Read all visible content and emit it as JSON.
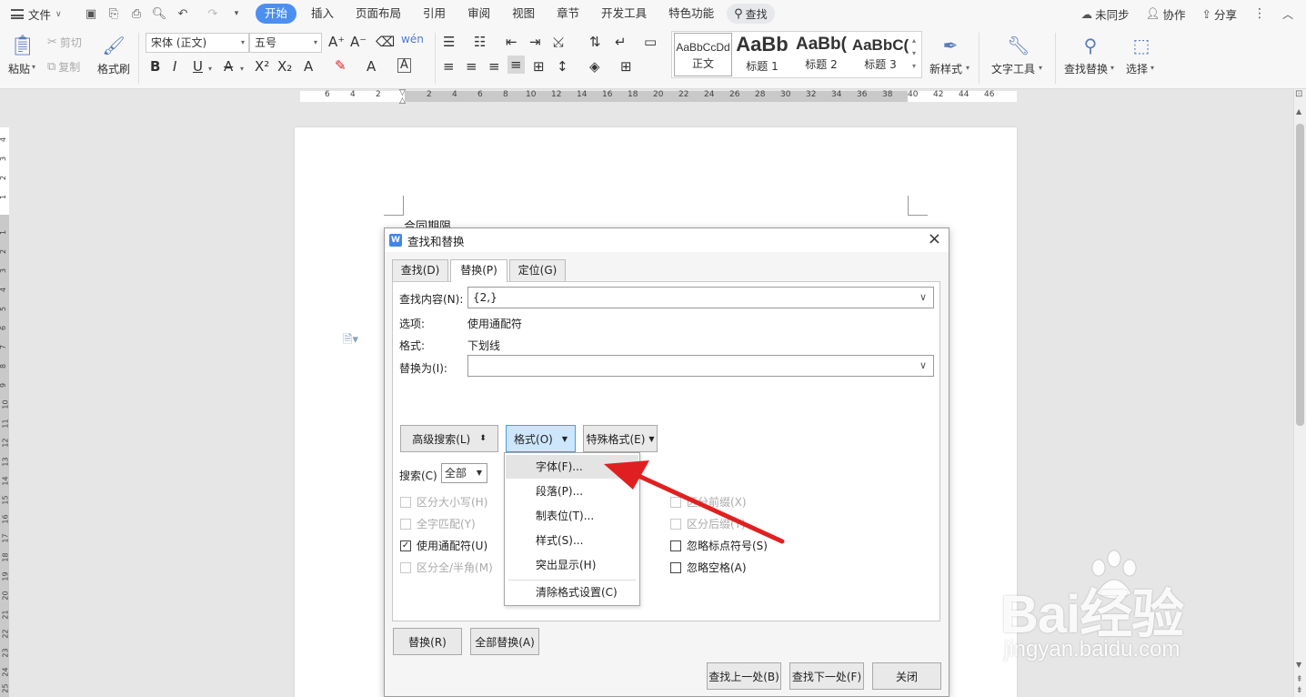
{
  "menubar": {
    "file": "文件",
    "tabs": [
      {
        "label": "开始",
        "active": true
      },
      {
        "label": "插入"
      },
      {
        "label": "页面布局"
      },
      {
        "label": "引用"
      },
      {
        "label": "审阅"
      },
      {
        "label": "视图"
      },
      {
        "label": "章节"
      },
      {
        "label": "开发工具"
      },
      {
        "label": "特色功能"
      }
    ],
    "search": "查找",
    "sync": "未同步",
    "collab": "协作",
    "share": "分享"
  },
  "ribbon": {
    "paste": "粘贴",
    "cut": "剪切",
    "copy": "复制",
    "format_painter": "格式刷",
    "font_name": "宋体 (正文)",
    "font_size": "五号",
    "styles": [
      {
        "preview": "AaBbCcDd",
        "name": "正文"
      },
      {
        "preview": "AaBb",
        "name": "标题 1"
      },
      {
        "preview": "AaBb(",
        "name": "标题 2"
      },
      {
        "preview": "AaBbC(",
        "name": "标题 3"
      }
    ],
    "new_style": "新样式",
    "text_tools": "文字工具",
    "find_replace": "查找替换",
    "select": "选择"
  },
  "ruler": {
    "left_nums": [
      "6",
      "4",
      "2"
    ],
    "nums": [
      "2",
      "4",
      "6",
      "8",
      "10",
      "12",
      "14",
      "16",
      "18",
      "20",
      "22",
      "24",
      "26",
      "28",
      "30",
      "32",
      "34",
      "36",
      "38",
      "40",
      "42",
      "44",
      "46"
    ],
    "vnums": [
      "4",
      "3",
      "2",
      "1",
      "1",
      "2",
      "3",
      "4",
      "5",
      "6",
      "7",
      "8",
      "9",
      "10",
      "11",
      "12",
      "13",
      "14",
      "15",
      "16",
      "17",
      "18",
      "19",
      "20",
      "21",
      "22",
      "23",
      "24",
      "25"
    ]
  },
  "document": {
    "text": "合同期限"
  },
  "dialog": {
    "title": "查找和替换",
    "close": "×",
    "tabs": [
      "查找(D)",
      "替换(P)",
      "定位(G)"
    ],
    "find_label": "查找内容(N):",
    "find_value": "{2,}",
    "options_label": "选项:",
    "options_value": "使用通配符",
    "format_label": "格式:",
    "format_value": "下划线",
    "replace_label": "替换为(I):",
    "replace_value": "",
    "advanced_btn": "高级搜索(L)",
    "format_btn": "格式(O)",
    "special_btn": "特殊格式(E)",
    "search_label": "搜索(C)",
    "search_value": "全部",
    "checkboxes_left": [
      {
        "label": "区分大小写(H)",
        "checked": false,
        "enabled": false
      },
      {
        "label": "全字匹配(Y)",
        "checked": false,
        "enabled": false
      },
      {
        "label": "使用通配符(U)",
        "checked": true,
        "enabled": true
      },
      {
        "label": "区分全/半角(M)",
        "checked": false,
        "enabled": false
      }
    ],
    "checkboxes_right": [
      {
        "label": "区分前缀(X)",
        "checked": false,
        "enabled": false
      },
      {
        "label": "区分后缀(T)",
        "checked": false,
        "enabled": false
      },
      {
        "label": "忽略标点符号(S)",
        "checked": false,
        "enabled": true
      },
      {
        "label": "忽略空格(A)",
        "checked": false,
        "enabled": true
      }
    ],
    "replace_btn": "替换(R)",
    "replace_all_btn": "全部替换(A)",
    "find_prev_btn": "查找上一处(B)",
    "find_next_btn": "查找下一处(F)",
    "close_btn": "关闭"
  },
  "format_menu": {
    "items": [
      "字体(F)...",
      "段落(P)...",
      "制表位(T)...",
      "样式(S)...",
      "突出显示(H)",
      "清除格式设置(C)"
    ]
  },
  "watermark": {
    "brand": "Bai经验",
    "url": "jingyan.baidu.com"
  },
  "colors": {
    "accent": "#4d8ff0",
    "arrow": "#e02020"
  }
}
